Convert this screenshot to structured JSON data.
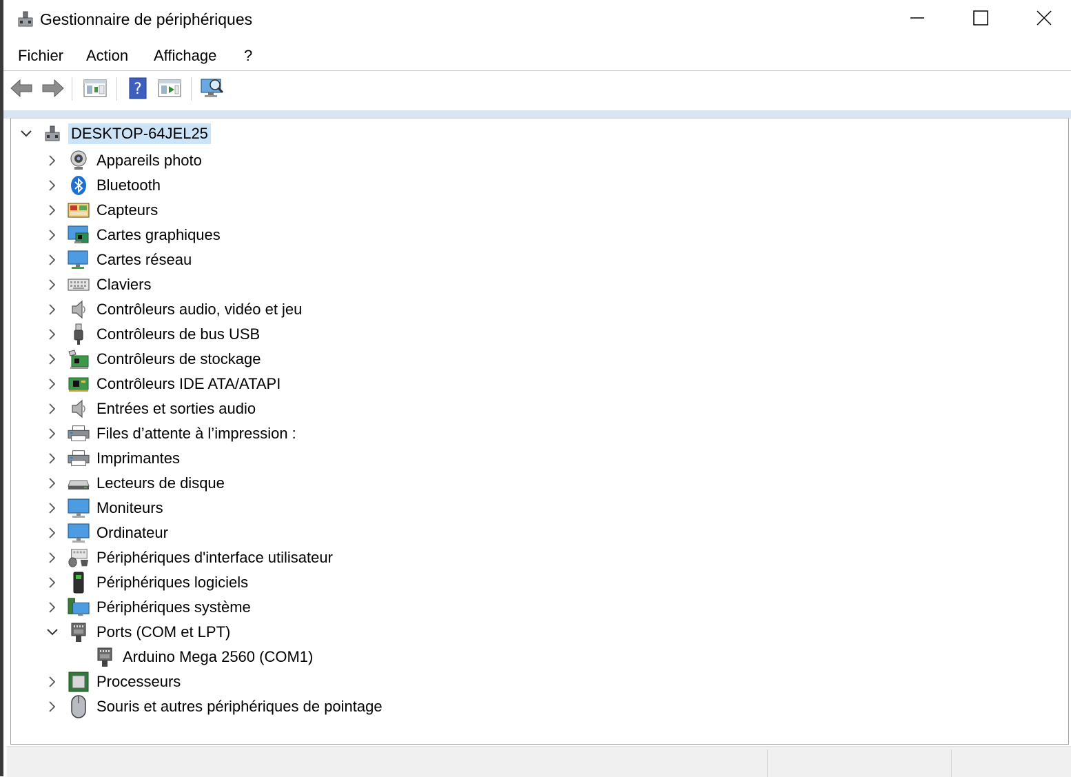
{
  "window": {
    "title": "Gestionnaire de périphériques",
    "controls": [
      "minimize",
      "maximize",
      "close"
    ]
  },
  "menu": {
    "items": [
      "Fichier",
      "Action",
      "Affichage",
      "?"
    ]
  },
  "toolbar": {
    "buttons": [
      {
        "name": "back-arrow-icon"
      },
      {
        "name": "forward-arrow-icon"
      },
      {
        "name": "properties-view-icon"
      },
      {
        "name": "help-icon"
      },
      {
        "name": "update-driver-icon"
      },
      {
        "name": "scan-hardware-icon"
      }
    ]
  },
  "tree": {
    "root": {
      "label": "DESKTOP-64JEL25",
      "expanded": true
    },
    "categories": [
      {
        "label": "Appareils photo",
        "icon": "camera-icon",
        "expanded": false
      },
      {
        "label": "Bluetooth",
        "icon": "bluetooth-icon",
        "expanded": false
      },
      {
        "label": "Capteurs",
        "icon": "sensors-icon",
        "expanded": false
      },
      {
        "label": "Cartes graphiques",
        "icon": "display-adapter-icon",
        "expanded": false
      },
      {
        "label": "Cartes réseau",
        "icon": "network-adapter-icon",
        "expanded": false
      },
      {
        "label": "Claviers",
        "icon": "keyboard-icon",
        "expanded": false
      },
      {
        "label": "Contrôleurs audio, vidéo et jeu",
        "icon": "speaker-icon",
        "expanded": false
      },
      {
        "label": "Contrôleurs de bus USB",
        "icon": "usb-icon",
        "expanded": false
      },
      {
        "label": "Contrôleurs de stockage",
        "icon": "storage-controller-icon",
        "expanded": false
      },
      {
        "label": "Contrôleurs IDE ATA/ATAPI",
        "icon": "ide-controller-icon",
        "expanded": false
      },
      {
        "label": "Entrées et sorties audio",
        "icon": "audio-io-icon",
        "expanded": false
      },
      {
        "label": "Files d’attente à l’impression :",
        "icon": "print-queue-icon",
        "expanded": false
      },
      {
        "label": "Imprimantes",
        "icon": "printer-icon",
        "expanded": false
      },
      {
        "label": "Lecteurs de disque",
        "icon": "disk-drive-icon",
        "expanded": false
      },
      {
        "label": "Moniteurs",
        "icon": "monitor-icon",
        "expanded": false
      },
      {
        "label": "Ordinateur",
        "icon": "computer-icon",
        "expanded": false
      },
      {
        "label": "Périphériques d'interface utilisateur",
        "icon": "hid-icon",
        "expanded": false
      },
      {
        "label": "Périphériques logiciels",
        "icon": "software-device-icon",
        "expanded": false
      },
      {
        "label": "Périphériques système",
        "icon": "system-device-icon",
        "expanded": false
      },
      {
        "label": "Ports (COM et LPT)",
        "icon": "port-icon",
        "expanded": true,
        "children": [
          {
            "label": "Arduino Mega 2560 (COM1)",
            "icon": "port-icon"
          }
        ]
      },
      {
        "label": "Processeurs",
        "icon": "processor-icon",
        "expanded": false
      },
      {
        "label": "Souris et autres périphériques de pointage",
        "icon": "mouse-icon",
        "expanded": false
      }
    ]
  },
  "colors": {
    "selection": "#cce4f7",
    "band": "#dbe5f1",
    "statusbar": "#f0f0f0"
  }
}
